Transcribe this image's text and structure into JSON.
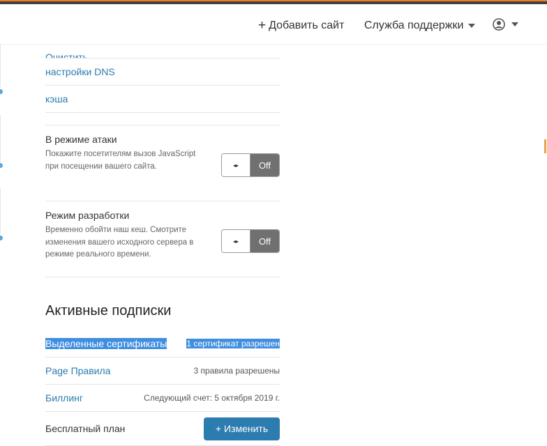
{
  "header": {
    "add_site_label": "Добавить сайт",
    "add_site_prefix": "+",
    "support_label": "Служба поддержки"
  },
  "links": {
    "clear_label": "Очистить",
    "dns_label": "настройки DNS",
    "cache_label": "кэша"
  },
  "settings": [
    {
      "title": "В режиме атаки",
      "description": "Покажите посетителям вызов JavaScript при посещении вашего сайта.",
      "state": "Off",
      "handle": "◂▸"
    },
    {
      "title": "Режим разработки",
      "description": "Временно обойти наш кеш. Смотрите изменения вашего исходного сервера в режиме реального времени.",
      "state": "Off",
      "handle": "◂▸"
    }
  ],
  "subscriptions": {
    "title": "Активные подписки",
    "rows": [
      {
        "name": "Выделенные сертификаты",
        "value": "1 сертификат разрешен"
      },
      {
        "name": "Page Правила",
        "value": "3 правила разрешены"
      },
      {
        "name": "Биллинг",
        "value": "Следующий счет: 5 октября 2019 г."
      }
    ],
    "plan_label": "Бесплатный план",
    "change_button": "+ Изменить"
  },
  "colors": {
    "accent_orange": "#f38020",
    "link_blue": "#2c7cb0",
    "button_blue": "#2c7cb0",
    "toggle_off_gray": "#707070",
    "selection_blue": "#3f8ee0"
  }
}
